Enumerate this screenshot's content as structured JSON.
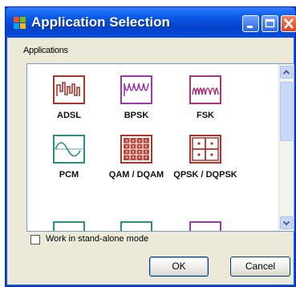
{
  "window": {
    "title": "Application Selection"
  },
  "section": {
    "label": "Applications"
  },
  "applications": [
    {
      "label": "ADSL",
      "icon": "adsl-waveform-icon",
      "color": "#a8362c"
    },
    {
      "label": "BPSK",
      "icon": "bpsk-waveform-icon",
      "color": "#9a3aa8"
    },
    {
      "label": "FSK",
      "icon": "fsk-waveform-icon",
      "color": "#a8367a"
    },
    {
      "label": "PCM",
      "icon": "pcm-waveform-icon",
      "color": "#2a8d8a"
    },
    {
      "label": "QAM / DQAM",
      "icon": "qam-constellation-icon",
      "color": "#a8362c"
    },
    {
      "label": "QPSK / DQPSK",
      "icon": "qpsk-constellation-icon",
      "color": "#a8362c"
    }
  ],
  "options": {
    "standalone_label": "Work in stand-alone mode",
    "standalone_checked": false
  },
  "buttons": {
    "ok": "OK",
    "cancel": "Cancel"
  }
}
